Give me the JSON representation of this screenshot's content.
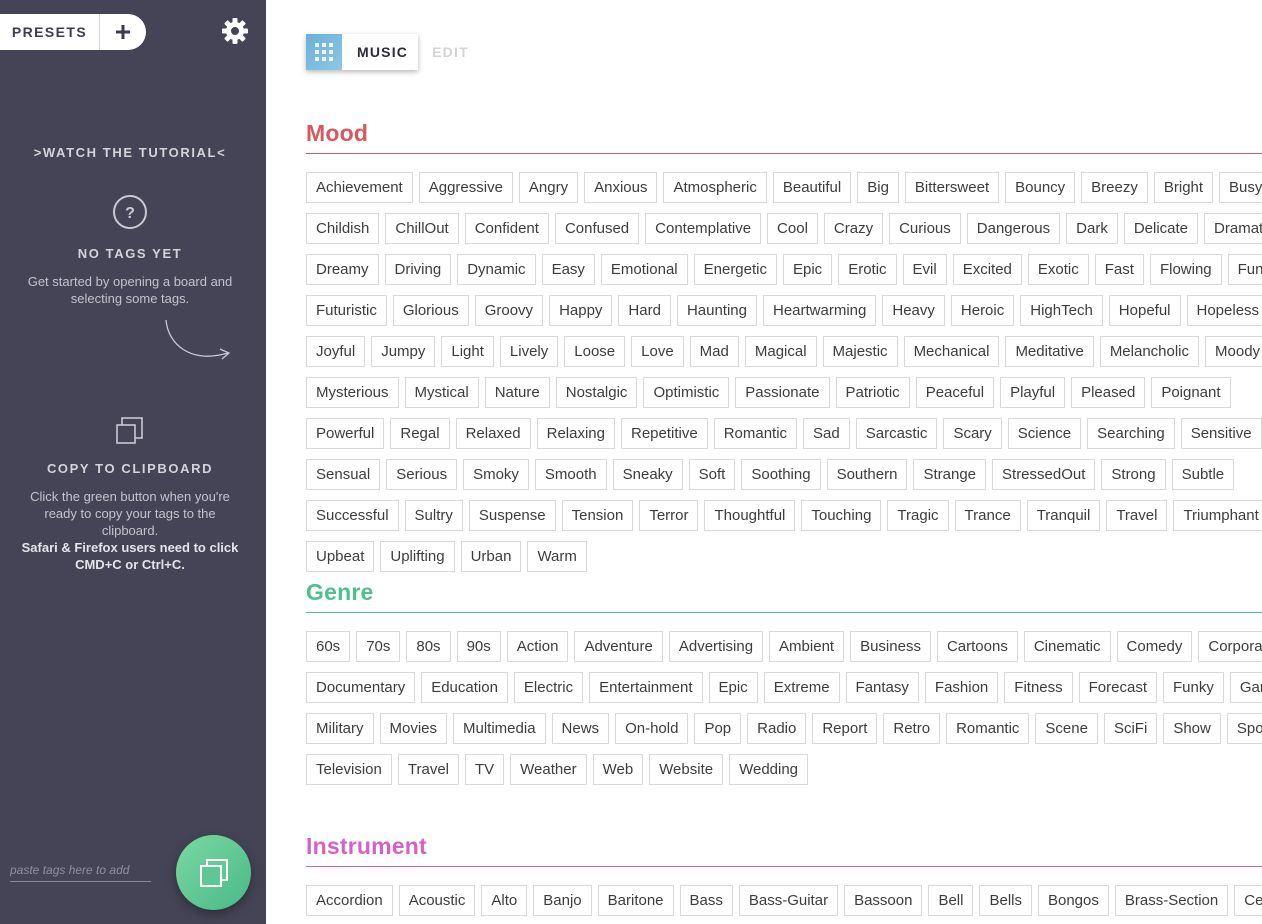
{
  "sidebar": {
    "presets_label": "PRESETS",
    "tutorial_link": ">WATCH THE TUTORIAL<",
    "no_tags_title": "NO TAGS YET",
    "no_tags_text": "Get started by opening a board and selecting some tags.",
    "copy_title": "COPY TO CLIPBOARD",
    "copy_text": "Click the green button when you're ready to copy your tags to the clipboard.",
    "copy_note": "Safari & Firefox users need to click CMD+C or Ctrl+C.",
    "paste_placeholder": "paste tags here to add",
    "icons": [
      "plus-icon",
      "gear-icon",
      "question-icon",
      "curved-arrow-icon",
      "copy-icon"
    ]
  },
  "header": {
    "music_tab": "MUSIC",
    "edit_tab": "EDIT"
  },
  "colors": {
    "sidebar_bg": "#444456",
    "mood": "#d5595f",
    "genre": "#4cc18d",
    "instrument": "#d561c4",
    "copy_button": "#5cc894"
  },
  "categories": [
    {
      "title": "Mood",
      "color": "#d5595f",
      "tags": [
        "Achievement",
        "Aggressive",
        "Angry",
        "Anxious",
        "Atmospheric",
        "Beautiful",
        "Big",
        "Bittersweet",
        "Bouncy",
        "Breezy",
        "Bright",
        "Busy",
        "Childish",
        "ChillOut",
        "Confident",
        "Confused",
        "Contemplative",
        "Cool",
        "Crazy",
        "Curious",
        "Dangerous",
        "Dark",
        "Delicate",
        "Dramatic",
        "Dreamy",
        "Driving",
        "Dynamic",
        "Easy",
        "Emotional",
        "Energetic",
        "Epic",
        "Erotic",
        "Evil",
        "Excited",
        "Exotic",
        "Fast",
        "Flowing",
        "Fun",
        "Futuristic",
        "Glorious",
        "Groovy",
        "Happy",
        "Hard",
        "Haunting",
        "Heartwarming",
        "Heavy",
        "Heroic",
        "HighTech",
        "Hopeful",
        "Hopeless",
        "Joyful",
        "Jumpy",
        "Light",
        "Lively",
        "Loose",
        "Love",
        "Mad",
        "Magical",
        "Majestic",
        "Mechanical",
        "Meditative",
        "Melancholic",
        "Moody",
        "Mysterious",
        "Mystical",
        "Nature",
        "Nostalgic",
        "Optimistic",
        "Passionate",
        "Patriotic",
        "Peaceful",
        "Playful",
        "Pleased",
        "Poignant",
        "Powerful",
        "Regal",
        "Relaxed",
        "Relaxing",
        "Repetitive",
        "Romantic",
        "Sad",
        "Sarcastic",
        "Scary",
        "Science",
        "Searching",
        "Sensitive",
        "Sensual",
        "Serious",
        "Smoky",
        "Smooth",
        "Sneaky",
        "Soft",
        "Soothing",
        "Southern",
        "Strange",
        "StressedOut",
        "Strong",
        "Subtle",
        "Successful",
        "Sultry",
        "Suspense",
        "Tension",
        "Terror",
        "Thoughtful",
        "Touching",
        "Tragic",
        "Trance",
        "Tranquil",
        "Travel",
        "Triumphant",
        "Upbeat",
        "Uplifting",
        "Urban",
        "Warm"
      ]
    },
    {
      "title": "Genre",
      "color": "#4cc18d",
      "tags": [
        "60s",
        "70s",
        "80s",
        "90s",
        "Action",
        "Adventure",
        "Advertising",
        "Ambient",
        "Business",
        "Cartoons",
        "Cinematic",
        "Comedy",
        "Corporate",
        "Documentary",
        "Education",
        "Electric",
        "Entertainment",
        "Epic",
        "Extreme",
        "Fantasy",
        "Fashion",
        "Fitness",
        "Forecast",
        "Funky",
        "Games",
        "Military",
        "Movies",
        "Multimedia",
        "News",
        "On-hold",
        "Pop",
        "Radio",
        "Report",
        "Retro",
        "Romantic",
        "Scene",
        "SciFi",
        "Show",
        "Sports",
        "Television",
        "Travel",
        "TV",
        "Weather",
        "Web",
        "Website",
        "Wedding"
      ]
    },
    {
      "title": "Instrument",
      "color": "#d561c4",
      "tags": [
        "Accordion",
        "Acoustic",
        "Alto",
        "Banjo",
        "Baritone",
        "Bass",
        "Bass-Guitar",
        "Bassoon",
        "Bell",
        "Bells",
        "Bongos",
        "Brass-Section",
        "Cello"
      ]
    }
  ]
}
